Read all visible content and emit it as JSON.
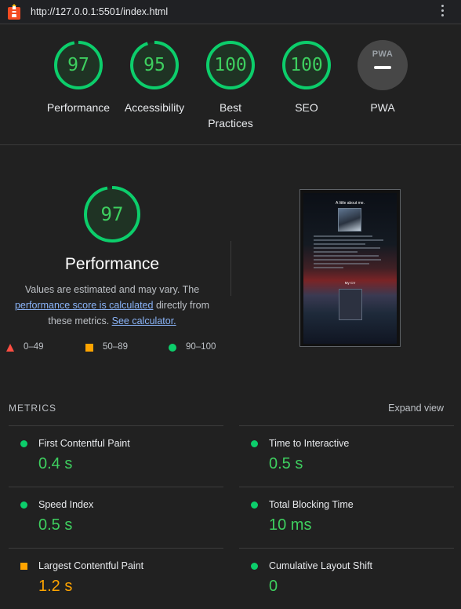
{
  "topbar": {
    "url": "http://127.0.0.1:5501/index.html"
  },
  "categories": [
    {
      "label": "Performance",
      "score": "97",
      "fraction": 0.97
    },
    {
      "label": "Accessibility",
      "score": "95",
      "fraction": 0.95
    },
    {
      "label": "Best Practices",
      "score": "100",
      "fraction": 1.0
    },
    {
      "label": "SEO",
      "score": "100",
      "fraction": 1.0
    },
    {
      "label": "PWA",
      "badge": "PWA"
    }
  ],
  "performance": {
    "score": "97",
    "fraction": 0.97,
    "title": "Performance",
    "desc_prefix": "Values are estimated and may vary. The ",
    "desc_link1": "performance score is calculated",
    "desc_middle": " directly from these metrics. ",
    "desc_link2": "See calculator.",
    "legend": {
      "fail": "0–49",
      "average": "50–89",
      "pass": "90–100"
    }
  },
  "screenshot": {
    "title": "A little about me.",
    "cv_title": "My CV"
  },
  "metrics": {
    "header": "METRICS",
    "expand": "Expand view",
    "items": [
      {
        "name": "First Contentful Paint",
        "value": "0.4 s",
        "rating": "pass"
      },
      {
        "name": "Time to Interactive",
        "value": "0.5 s",
        "rating": "pass"
      },
      {
        "name": "Speed Index",
        "value": "0.5 s",
        "rating": "pass"
      },
      {
        "name": "Total Blocking Time",
        "value": "10 ms",
        "rating": "pass"
      },
      {
        "name": "Largest Contentful Paint",
        "value": "1.2 s",
        "rating": "average"
      },
      {
        "name": "Cumulative Layout Shift",
        "value": "0",
        "rating": "pass"
      }
    ]
  },
  "colors": {
    "pass": "#0cce6b",
    "average": "#ffa400",
    "fail": "#ff4e42",
    "pass_text": "#3ecf5f"
  }
}
